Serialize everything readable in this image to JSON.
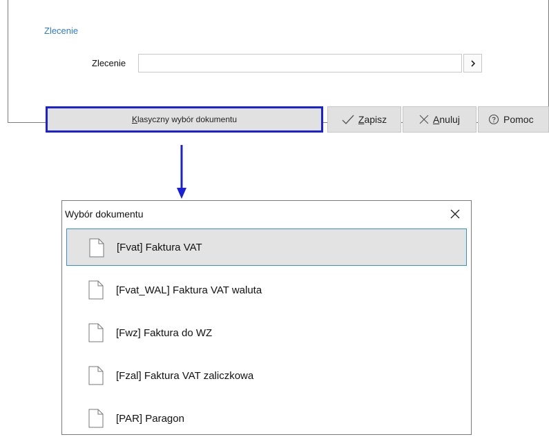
{
  "top_dialog": {
    "section_title": "Zlecenie",
    "field_label": "Zlecenie",
    "field_value": "",
    "buttons": {
      "classic_prefix": "K",
      "classic_rest": "lasyczny wybór dokumentu",
      "save_under": "Z",
      "save_rest": "apisz",
      "cancel_under": "A",
      "cancel_rest": "nuluj",
      "help_label": "Pomoc"
    }
  },
  "pick_dialog": {
    "title": "Wybór dokumentu",
    "items": [
      {
        "label": "[Fvat] Faktura VAT",
        "selected": true
      },
      {
        "label": "[Fvat_WAL] Faktura VAT waluta",
        "selected": false
      },
      {
        "label": "[Fwz] Faktura do WZ",
        "selected": false
      },
      {
        "label": "[Fzal] Faktura VAT zaliczkowa",
        "selected": false
      },
      {
        "label": "[PAR] Paragon",
        "selected": false
      }
    ]
  },
  "colors": {
    "highlight_border": "#1a1fd8",
    "arrow": "#1a1fd8",
    "selection_border": "#2f8fd8",
    "section_title": "#2b7bd0"
  },
  "icons": {
    "field_select": "chevron-right-icon",
    "save": "check-icon",
    "cancel": "close-icon",
    "help": "help-circle-icon",
    "dialog_close": "close-icon",
    "document": "document-icon"
  }
}
